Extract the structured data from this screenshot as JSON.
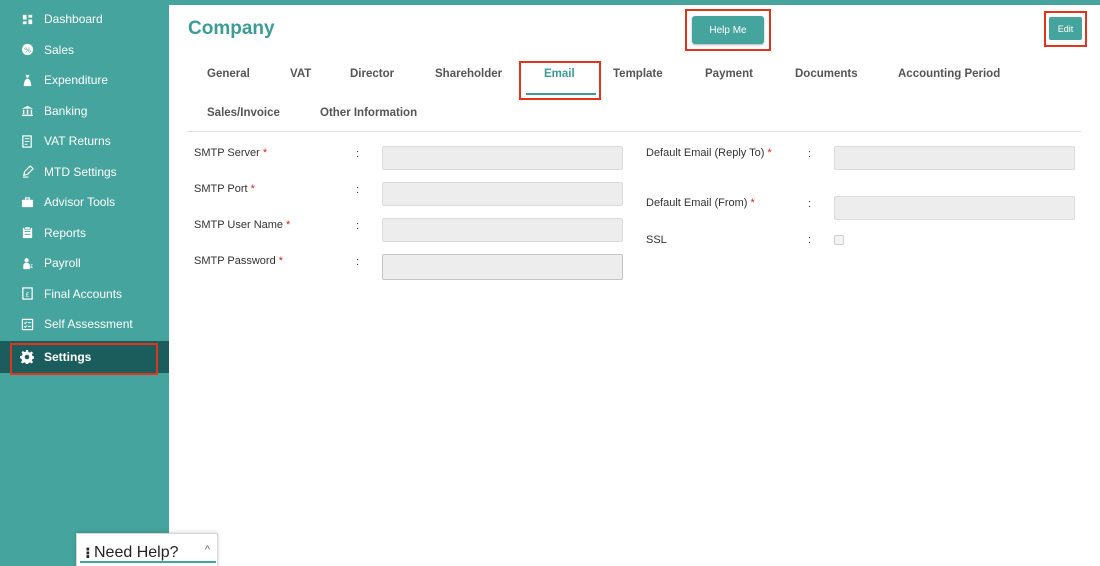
{
  "sidebar": {
    "items": [
      {
        "label": "Dashboard",
        "icon": "dashboard-icon"
      },
      {
        "label": "Sales",
        "icon": "sales-icon"
      },
      {
        "label": "Expenditure",
        "icon": "expenditure-icon"
      },
      {
        "label": "Banking",
        "icon": "bank-icon"
      },
      {
        "label": "VAT Returns",
        "icon": "vat-returns-icon"
      },
      {
        "label": "MTD Settings",
        "icon": "mtd-settings-icon"
      },
      {
        "label": "Advisor Tools",
        "icon": "briefcase-icon"
      },
      {
        "label": "Reports",
        "icon": "reports-icon"
      },
      {
        "label": "Payroll",
        "icon": "payroll-icon"
      },
      {
        "label": "Final Accounts",
        "icon": "final-accounts-icon"
      },
      {
        "label": "Self Assessment",
        "icon": "self-assessment-icon"
      },
      {
        "label": "Settings",
        "icon": "gear-icon",
        "active": true
      }
    ]
  },
  "header": {
    "title": "Company",
    "help_label": "Help Me",
    "edit_label": "Edit"
  },
  "tabs": [
    {
      "label": "General"
    },
    {
      "label": "VAT"
    },
    {
      "label": "Director"
    },
    {
      "label": "Shareholder"
    },
    {
      "label": "Email",
      "active": true
    },
    {
      "label": "Template"
    },
    {
      "label": "Payment"
    },
    {
      "label": "Documents"
    },
    {
      "label": "Accounting Period"
    },
    {
      "label": "Sales/Invoice"
    },
    {
      "label": "Other Information"
    }
  ],
  "form": {
    "left": [
      {
        "label": "SMTP Server",
        "required": "*",
        "value": ""
      },
      {
        "label": "SMTP Port",
        "required": "*",
        "value": ""
      },
      {
        "label": "SMTP User Name",
        "required": "*",
        "value": ""
      },
      {
        "label": "SMTP Password",
        "required": "*",
        "value": ""
      }
    ],
    "right": [
      {
        "label": "Default Email (Reply To)",
        "required": "*",
        "value": ""
      },
      {
        "label": "Default Email (From)",
        "required": "*",
        "value": ""
      },
      {
        "label": "SSL",
        "checked": false
      }
    ],
    "colon": ":"
  },
  "help_widget": {
    "label": "Need Help?",
    "grip": "⁝",
    "chevron": "^"
  },
  "colors": {
    "brand": "#45a49d",
    "active_nav": "#1b5d5d",
    "highlight": "#e0341c"
  }
}
